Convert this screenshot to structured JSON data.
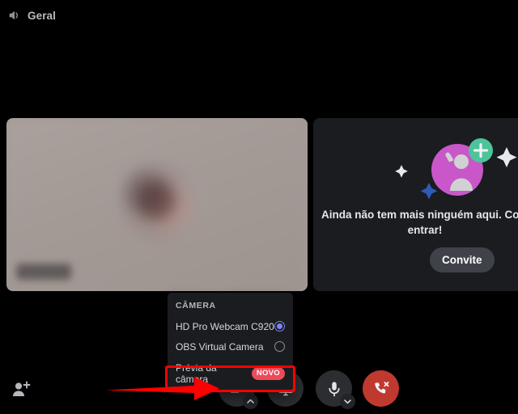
{
  "header": {
    "speaker_icon": "volume-speaker-icon",
    "channel_name": "Geral"
  },
  "stage": {
    "self_tile": {
      "name": "self-video-tile",
      "blurred": true,
      "name_badge_blurred": true,
      "background_color": "#a19995"
    },
    "empty_panel": {
      "message_line1": "Ainda não tem mais ninguém aqui. Convi",
      "message_line2": "entrar!",
      "invite_button_label": "Convite",
      "art": {
        "avatar_icon": "waving-person-icon",
        "plus_badge_icon": "plus-icon",
        "avatar_color": "#c957c9",
        "plus_badge_color": "#4ec49a",
        "sparkle_white_color": "#e8e9ea",
        "sparkle_blue_color": "#2f5bb7"
      },
      "background_color": "#1a1c20"
    }
  },
  "camera_menu": {
    "title": "CÂMERA",
    "options": [
      {
        "label": "HD Pro Webcam C920",
        "selected": true
      },
      {
        "label": "OBS Virtual Camera",
        "selected": false
      }
    ],
    "preview_item": {
      "label": "Prévia da câmera",
      "badge": "NOVO",
      "badge_color": "#eb4b5a",
      "highlighted": true
    },
    "radio_selected_color": "#7d86f0",
    "background_color": "#1a1c20"
  },
  "toolbar": {
    "add_people_icon": "person-add-icon",
    "buttons": [
      {
        "name": "camera-button",
        "icon": "video-camera-icon",
        "chevron": "chevron-up-icon",
        "active": true
      },
      {
        "name": "screen-share-button",
        "icon": "screen-share-icon",
        "chevron": null,
        "active": false
      },
      {
        "name": "microphone-button",
        "icon": "microphone-icon",
        "chevron": "chevron-down-icon",
        "active": false
      },
      {
        "name": "disconnect-button",
        "icon": "phone-hangup-icon",
        "chevron": null,
        "active": false
      }
    ],
    "disconnect_color": "#c0392f",
    "button_color": "#2b2d31"
  },
  "annotations": {
    "arrow": {
      "name": "red-arrow-annotation",
      "color": "#ff0000",
      "points_to": "camera-button"
    },
    "highlight_box": {
      "name": "red-highlight-box-annotation",
      "color": "#ff0000",
      "surrounds": "camera-preview-menu-item"
    }
  }
}
